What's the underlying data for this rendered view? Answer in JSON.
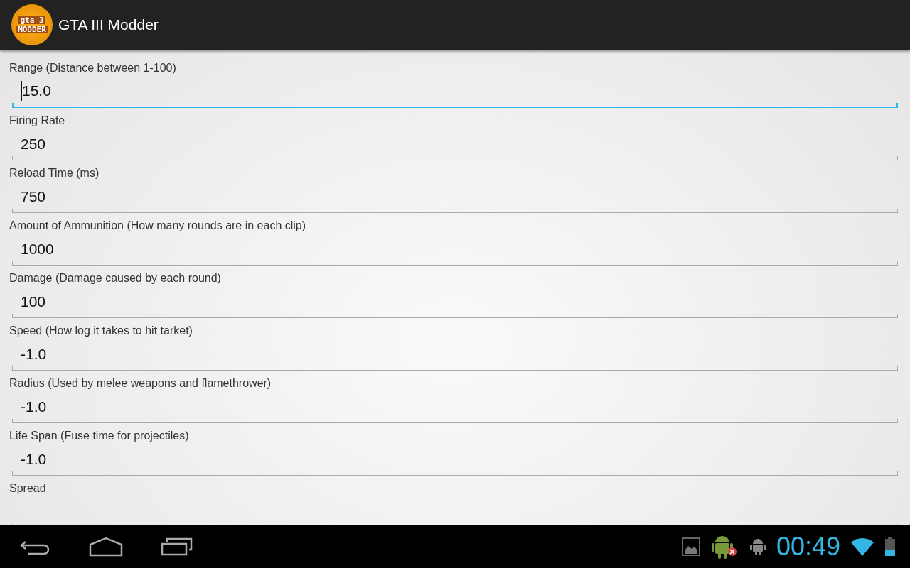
{
  "action_bar": {
    "logo_lines": [
      "gta 3",
      "MODDER"
    ],
    "title": "GTA III Modder"
  },
  "fields": [
    {
      "label": "Range (Distance between 1-100)",
      "value": "15.0",
      "focused": true
    },
    {
      "label": "Firing Rate",
      "value": "250",
      "focused": false
    },
    {
      "label": "Reload Time (ms)",
      "value": "750",
      "focused": false
    },
    {
      "label": "Amount of Ammunition (How many rounds are in each clip)",
      "value": "1000",
      "focused": false
    },
    {
      "label": "Damage (Damage caused by each round)",
      "value": "100",
      "focused": false
    },
    {
      "label": "Speed (How log it takes to hit tarket)",
      "value": "-1.0",
      "focused": false
    },
    {
      "label": "Radius (Used by melee weapons and flamethrower)",
      "value": "-1.0",
      "focused": false
    },
    {
      "label": "Life Span (Fuse time for projectiles)",
      "value": "-1.0",
      "focused": false
    },
    {
      "label": "Spread",
      "focused": false
    }
  ],
  "status_bar": {
    "time": "00:49"
  }
}
